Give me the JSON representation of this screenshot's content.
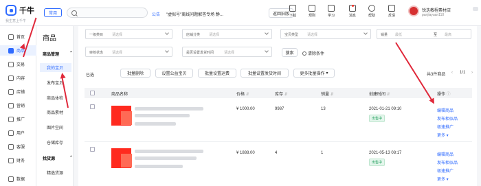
{
  "header": {
    "brand": "千牛",
    "brand_sub": "我生意上千牛",
    "mode_pill": "常用",
    "notice_tag": "公告",
    "notice_text": "\"虚拟号\"离线问题解答专场 静...",
    "old_version": "返回旧版",
    "tools": [
      {
        "label": "下载",
        "icon": "download-icon"
      },
      {
        "label": "规则",
        "icon": "rules-icon"
      },
      {
        "label": "学习",
        "icon": "learn-icon"
      },
      {
        "label": "消息",
        "icon": "message-icon"
      },
      {
        "label": "帮助",
        "icon": "help-icon"
      },
      {
        "label": "反馈",
        "icon": "feedback-icon"
      }
    ],
    "shop_name": "锐迭教程素材店",
    "shop_id": "panjiayuan110"
  },
  "left_nav": [
    {
      "label": "首页",
      "icon": "home-icon"
    },
    {
      "label": "商品",
      "icon": "goods-icon",
      "active": true
    },
    {
      "label": "交易",
      "icon": "trade-icon"
    },
    {
      "label": "内容",
      "icon": "content-icon"
    },
    {
      "label": "店铺",
      "icon": "store-icon"
    },
    {
      "label": "营销",
      "icon": "marketing-icon"
    },
    {
      "label": "推广",
      "icon": "promotion-icon"
    },
    {
      "label": "用户",
      "icon": "user-icon"
    },
    {
      "label": "客服",
      "icon": "service-icon"
    },
    {
      "label": "财务",
      "icon": "finance-icon"
    },
    {
      "label": "数据",
      "icon": "data-icon"
    }
  ],
  "sub_nav": {
    "title": "商品",
    "group1": "商品管理",
    "group1_items": [
      "我的宝贝",
      "发布宝贝",
      "商品体检",
      "商品素材",
      "图片空间",
      "仓储库存"
    ],
    "group2": "找货源",
    "group2_items": [
      "精选货源"
    ]
  },
  "filters": {
    "row1": [
      {
        "label": "一级类目",
        "placeholder": "请选择"
      },
      {
        "label": "店铺分类",
        "placeholder": "请选择"
      },
      {
        "label": "宝贝类型",
        "placeholder": "请选择"
      },
      {
        "label": "销量",
        "min": "最低",
        "sep": "至",
        "max": "最高"
      }
    ],
    "row2": [
      {
        "label": "审核状态",
        "placeholder": "请选择"
      },
      {
        "label": "是否设置发货时间",
        "placeholder": "请选择"
      },
      {
        "label": "",
        "placeholder": "请选择"
      }
    ],
    "search": "搜索",
    "clear": "清除条件"
  },
  "actions": {
    "selected": "已选",
    "buttons": [
      "批量删除",
      "设置公益宝贝",
      "批量设置运费",
      "批量设置发货时间"
    ],
    "more": "更多批量操作",
    "total": "共3件商品",
    "page": "1/1"
  },
  "table": {
    "headers": [
      "商品名称",
      "价格",
      "库存",
      "销量",
      "创建时间",
      "操作"
    ],
    "rows": [
      {
        "price": "¥ 1000.00",
        "stock": "9987",
        "sales": "13",
        "created": "2021-01-21 09:10",
        "status": "出售中",
        "ops": [
          "编辑商品",
          "发布相似品",
          "极速推广",
          "更多"
        ]
      },
      {
        "price": "¥ 1888.00",
        "stock": "4",
        "sales": "1",
        "created": "2021-05-13 08:17",
        "status": "出售中",
        "ops": [
          "编辑商品",
          "发布相似品",
          "极速推广",
          "更多"
        ]
      }
    ]
  },
  "colors": {
    "accent": "#2f6bff",
    "annotation": "#e0283a",
    "product_thumb": "#ff2a1f"
  }
}
